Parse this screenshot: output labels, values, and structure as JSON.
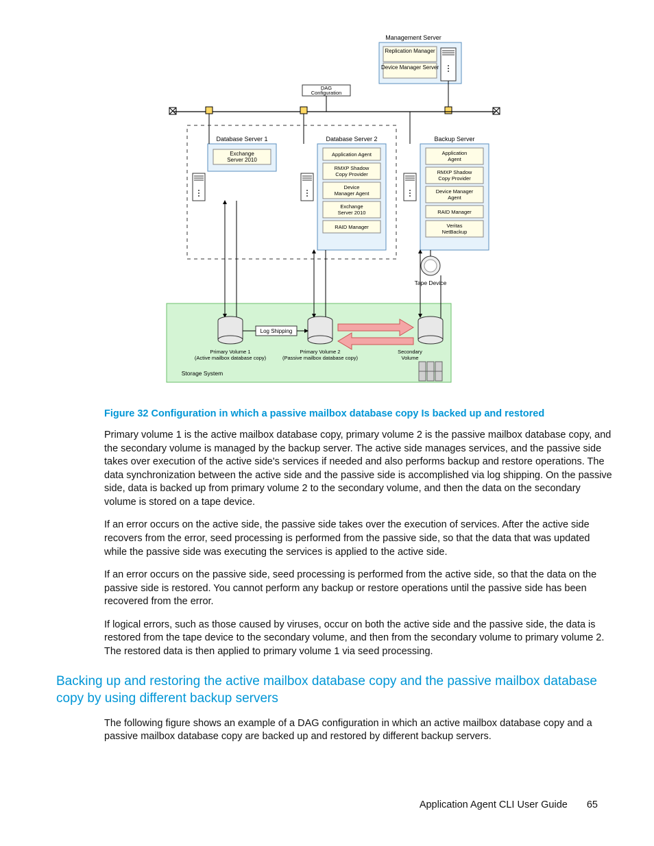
{
  "diagram": {
    "mgmt_server_label": "Management Server",
    "mgmt_boxes": [
      "Replication Manager",
      "Device Manager Server"
    ],
    "dag_label": "DAG Configuration",
    "db1_label": "Database Server 1",
    "db2_label": "Database Server 2",
    "backup_label": "Backup Server",
    "db1_boxes": [
      "Exchange Server 2010"
    ],
    "db2_boxes": [
      "Application Agent",
      "RMXP Shadow Copy Provider",
      "Device Manager Agent",
      "Exchange Server 2010",
      "RAID Manager"
    ],
    "backup_boxes": [
      "Application Agent",
      "RMXP Shadow Copy Provider",
      "Device Manager Agent",
      "RAID Manager",
      "Veritas NetBackup"
    ],
    "tape_label": "Tape Device",
    "log_shipping": "Log Shipping",
    "pv1_line1": "Primary Volume 1",
    "pv1_line2": "(Active mailbox database copy)",
    "pv2_line1": "Primary Volume 2",
    "pv2_line2": "(Passive mailbox database copy)",
    "sv_line1": "Secondary",
    "sv_line2": "Volume",
    "storage_label": "Storage System"
  },
  "figure_caption": "Figure 32 Configuration in which a passive mailbox database copy Is backed up and restored",
  "para1": "Primary volume 1 is the active mailbox database copy, primary volume 2 is the passive mailbox database copy, and the secondary volume is managed by the backup server. The active side manages services, and the passive side takes over execution of the active side's services if needed and also performs backup and restore operations. The data synchronization between the active side and the passive side is accomplished via log shipping. On the passive side, data is backed up from primary volume 2 to the secondary volume, and then the data on the secondary volume is stored on a tape device.",
  "para2": "If an error occurs on the active side, the passive side takes over the execution of services. After the active side recovers from the error, seed processing is performed from the passive side, so that the data that was updated while the passive side was executing the services is applied to the active side.",
  "para3": "If an error occurs on the passive side, seed processing is performed from the active side, so that the data on the passive side is restored. You cannot perform any backup or restore operations until the passive side has been recovered from the error.",
  "para4": "If logical errors, such as those caused by viruses, occur on both the active side and the passive side, the data is restored from the tape device to the secondary volume, and then from the secondary volume to primary volume 2. The restored data is then applied to primary volume 1 via seed processing.",
  "section_heading": "Backing up and restoring the active mailbox database copy and the passive mailbox database copy by using different backup servers",
  "para5": "The following figure shows an example of a DAG configuration in which an active mailbox database copy and a passive mailbox database copy are backed up and restored by different backup servers.",
  "footer_text": "Application Agent CLI User Guide",
  "page_number": "65"
}
